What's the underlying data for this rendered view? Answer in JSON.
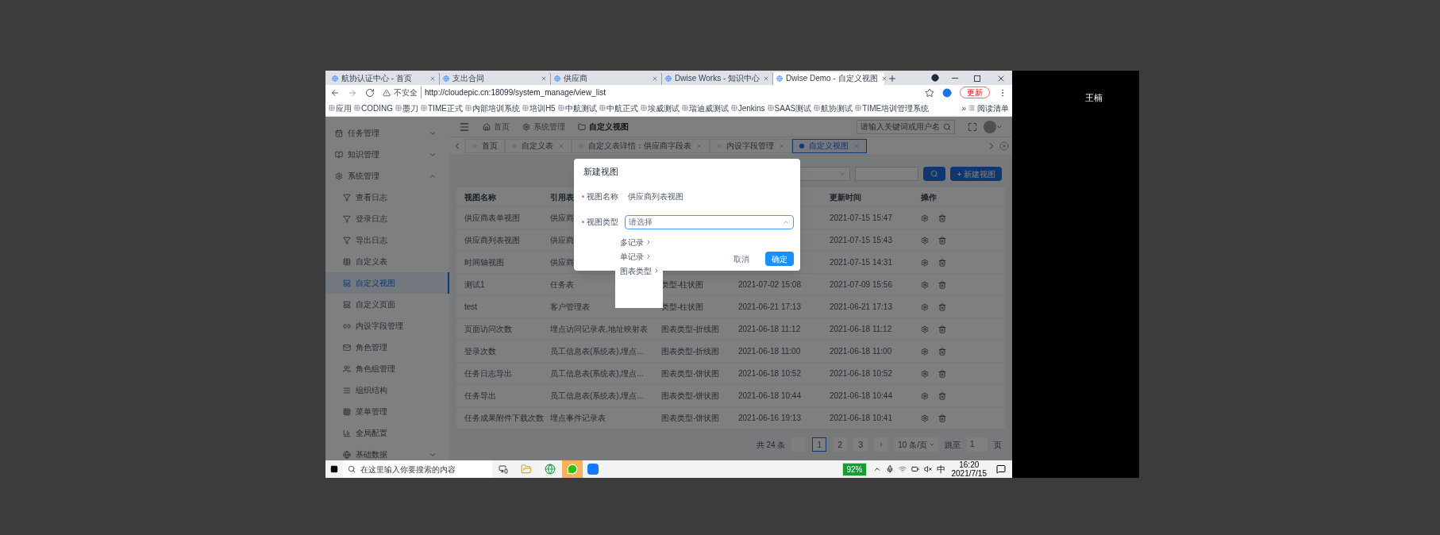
{
  "browser": {
    "tabs": [
      {
        "title": "航协认证中心 - 首页",
        "selected": false
      },
      {
        "title": "支出合同",
        "selected": false
      },
      {
        "title": "供应商",
        "selected": false
      },
      {
        "title": "Dwise Works - 知识中心",
        "selected": false
      },
      {
        "title": "Dwise Demo - 自定义视图",
        "selected": true
      }
    ],
    "address": {
      "security": "不安全",
      "url": "http://cloudepic.cn:18099/system_manage/view_list"
    },
    "update_button": "更新",
    "bookmarks": [
      "应用",
      "CODING",
      "墨刀",
      "TIME正式",
      "内部培训系统",
      "培训H5",
      "中航测试",
      "中航正式",
      "埃威测试",
      "瑞迪威测试",
      "Jenkins",
      "SAAS测试",
      "航协测试",
      "TIME培训管理系统"
    ],
    "more": "»",
    "reading_list": "阅读清单"
  },
  "app": {
    "sidebar": {
      "items": [
        {
          "label": "任务管理",
          "expanded": false
        },
        {
          "label": "知识管理",
          "expanded": false
        },
        {
          "label": "系统管理",
          "expanded": true,
          "children": [
            {
              "label": "查看日志",
              "selected": false
            },
            {
              "label": "登录日志",
              "selected": false
            },
            {
              "label": "导出日志",
              "selected": false
            },
            {
              "label": "自定义表",
              "selected": false
            },
            {
              "label": "自定义视图",
              "selected": true
            },
            {
              "label": "自定义页面",
              "selected": false
            },
            {
              "label": "内设字段管理",
              "selected": false
            },
            {
              "label": "角色管理",
              "selected": false
            },
            {
              "label": "角色组管理",
              "selected": false
            },
            {
              "label": "组织结构",
              "selected": false
            },
            {
              "label": "菜单管理",
              "selected": false
            },
            {
              "label": "全局配置",
              "selected": false
            },
            {
              "label": "基础数据",
              "selected": false,
              "expanded": false
            }
          ]
        }
      ]
    },
    "breadcrumb": [
      "首页",
      "系统管理",
      "自定义视图"
    ],
    "search": {
      "placeholder": "请输入关键词或用户名"
    },
    "tags": [
      {
        "label": "首页",
        "selected": false,
        "closable": false
      },
      {
        "label": "自定义表",
        "selected": false,
        "closable": true
      },
      {
        "label": "自定义表详情：供应商字段表",
        "selected": false,
        "closable": true
      },
      {
        "label": "内设字段管理",
        "selected": false,
        "closable": true
      },
      {
        "label": "自定义视图",
        "selected": true,
        "closable": true
      }
    ],
    "new_button": "+ 新建视图",
    "table": {
      "columns": [
        "视图名称",
        "引用表",
        null,
        null,
        "更新时间",
        "操作"
      ],
      "rows": [
        {
          "cells": [
            "供应商表单视图",
            "供应商",
            null,
            null,
            "2021-07-15 15:47"
          ]
        },
        {
          "cells": [
            "供应商列表视图",
            "供应商",
            null,
            null,
            "2021-07-15 15:43"
          ]
        },
        {
          "cells": [
            "时间轴视图",
            "供应商",
            null,
            null,
            "2021-07-15 14:31"
          ]
        },
        {
          "cells": [
            "测试1",
            "任务表",
            "类型-柱状图",
            "2021-07-02 15:08",
            "2021-07-09 15:56"
          ]
        },
        {
          "cells": [
            "test",
            "客户管理表",
            "类型-柱状图",
            "2021-06-21 17:13",
            "2021-06-21 17:13"
          ]
        },
        {
          "cells": [
            "页面访问次数",
            "埋点访问记录表,地址映射表",
            "图表类型-折线图",
            "2021-06-18 11:12",
            "2021-06-18 11:12"
          ]
        },
        {
          "cells": [
            "登录次数",
            "员工信息表(系统表),埋点...",
            "图表类型-折线图",
            "2021-06-18 11:00",
            "2021-06-18 11:00"
          ]
        },
        {
          "cells": [
            "任务日志导出",
            "员工信息表(系统表),埋点...",
            "图表类型-饼状图",
            "2021-06-18 10:52",
            "2021-06-18 10:52"
          ]
        },
        {
          "cells": [
            "任务导出",
            "员工信息表(系统表),埋点...",
            "图表类型-饼状图",
            "2021-06-18 10:44",
            "2021-06-18 10:44"
          ]
        },
        {
          "cells": [
            "任务成果附件下载次数",
            "埋点事件记录表",
            "图表类型-饼状图",
            "2021-06-16 19:13",
            "2021-06-18 10:41"
          ]
        }
      ]
    },
    "pagination": {
      "total": "共 24 条",
      "pages": [
        {
          "label": "1",
          "selected": true
        },
        {
          "label": "2",
          "selected": false
        },
        {
          "label": "3",
          "selected": false
        }
      ],
      "page_size": "10 条/页",
      "jump_label": "跳至",
      "jump_value": "1",
      "page_suffix": "页"
    }
  },
  "modal": {
    "title": "新建视图",
    "fields": [
      {
        "kind": "text",
        "label": "视图名称",
        "required": true,
        "value": "供应商列表视图"
      },
      {
        "kind": "select",
        "label": "视图类型",
        "required": true,
        "placeholder": "请选择",
        "expanded": true
      }
    ],
    "cascader": [
      "多记录",
      "单记录",
      "图表类型"
    ],
    "buttons": [
      {
        "label": "取消",
        "primary": false
      },
      {
        "label": "确定",
        "primary": true
      }
    ]
  },
  "taskbar": {
    "search_placeholder": "在这里输入你要搜索的内容",
    "battery": "92%",
    "ime": "中",
    "time": "16:20",
    "date": "2021/7/15"
  },
  "viewer_name": "王楠"
}
